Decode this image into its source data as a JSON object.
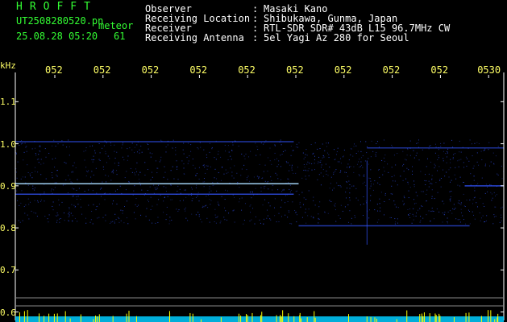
{
  "header": {
    "logo": "HROFFT",
    "file": "UT2508280520.pn",
    "meteor_label": "meteor",
    "date": "25.08.28 05:20",
    "count": "61",
    "meta": [
      {
        "label": "Observer",
        "value": "Masaki Kano"
      },
      {
        "label": "Receiving Location",
        "value": "Shibukawa, Gunma, Japan"
      },
      {
        "label": "Receiver",
        "value": "RTL-SDR SDR# 43dB L15 96.7MHz CW"
      },
      {
        "label": "Receiving Antenna",
        "value": "5el Yagi Az 280 for Seoul"
      }
    ]
  },
  "chart_data": {
    "type": "heatmap",
    "ylabel": "kHz",
    "y_ticks": [
      "1.1",
      "1.0",
      "0.9",
      "0.8",
      "0.7",
      "0.6"
    ],
    "y_tick_values": [
      1.1,
      1.0,
      0.9,
      0.8,
      0.7,
      0.6
    ],
    "x_ticks": [
      "052",
      "052",
      "052",
      "052",
      "052",
      "052",
      "052",
      "052",
      "052",
      "0530"
    ],
    "ylim": [
      0.58,
      1.16
    ],
    "grid": false,
    "colors": {
      "background": "#000000",
      "signal": "#3355ff",
      "signal_strong": "#aaddff",
      "axis": "#ffffff",
      "baseline": "#00ccff",
      "spikes": "#ffff00"
    },
    "signals": [
      {
        "freq_khz": 1.005,
        "x_start": 0.0,
        "x_end": 0.57,
        "strength": 0.5
      },
      {
        "freq_khz": 0.905,
        "x_start": 0.0,
        "x_end": 0.58,
        "strength": 1.0
      },
      {
        "freq_khz": 0.88,
        "x_start": 0.0,
        "x_end": 0.57,
        "strength": 0.7
      },
      {
        "freq_khz": 0.9,
        "x_start": 0.92,
        "x_end": 1.0,
        "strength": 0.8
      },
      {
        "freq_khz": 0.805,
        "x_start": 0.58,
        "x_end": 0.93,
        "strength": 0.5
      },
      {
        "freq_khz": 0.99,
        "x_start": 0.72,
        "x_end": 1.0,
        "strength": 0.4
      }
    ],
    "noise_band_khz": [
      0.81,
      1.01
    ]
  }
}
